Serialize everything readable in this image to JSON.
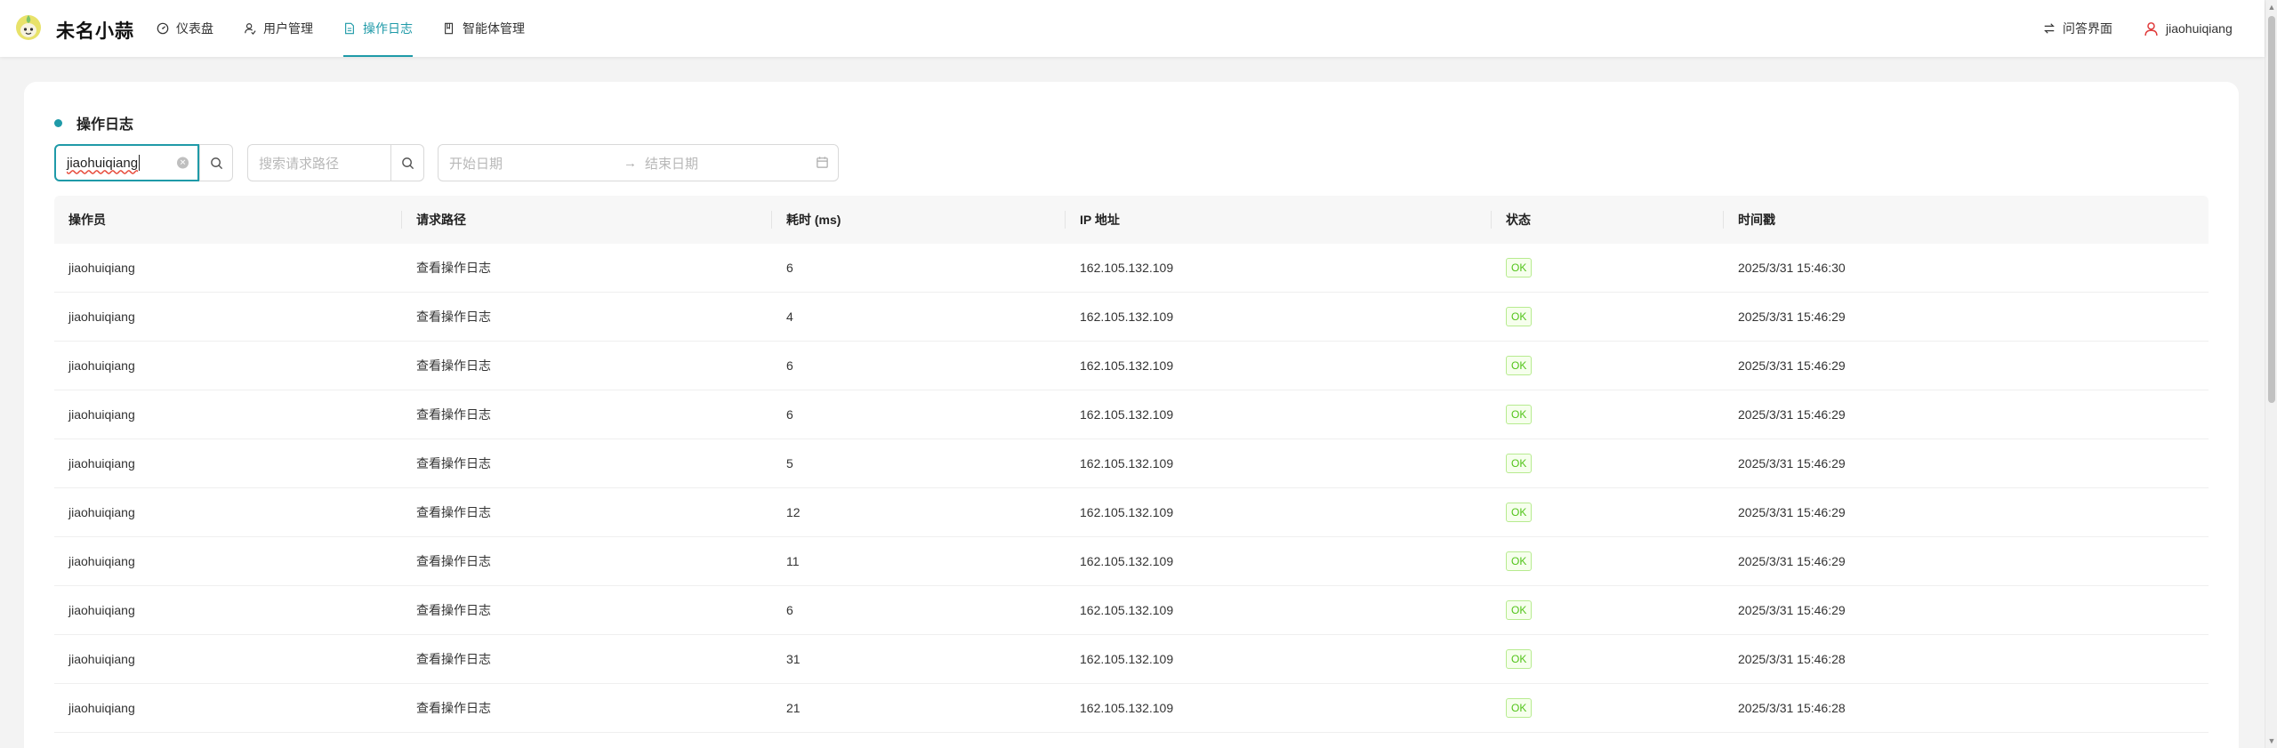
{
  "app": {
    "brand": "未名小蒜"
  },
  "nav": [
    {
      "label": "仪表盘",
      "icon": "dashboard-icon",
      "active": false
    },
    {
      "label": "用户管理",
      "icon": "user-manage-icon",
      "active": false
    },
    {
      "label": "操作日志",
      "icon": "document-icon",
      "active": true
    },
    {
      "label": "智能体管理",
      "icon": "book-icon",
      "active": false
    }
  ],
  "header_right": {
    "qa_label": "问答界面",
    "username": "jiaohuiqiang"
  },
  "page": {
    "title": "操作日志"
  },
  "filters": {
    "operator_value": "jiaohuiqiang",
    "path_placeholder": "搜索请求路径",
    "date_start_placeholder": "开始日期",
    "date_arrow": "→",
    "date_end_placeholder": "结束日期"
  },
  "table": {
    "columns": [
      "操作员",
      "请求路径",
      "耗时 (ms)",
      "IP 地址",
      "状态",
      "时间戳"
    ],
    "rows": [
      {
        "operator": "jiaohuiqiang",
        "path": "查看操作日志",
        "duration": "6",
        "ip": "162.105.132.109",
        "status": "OK",
        "timestamp": "2025/3/31 15:46:30"
      },
      {
        "operator": "jiaohuiqiang",
        "path": "查看操作日志",
        "duration": "4",
        "ip": "162.105.132.109",
        "status": "OK",
        "timestamp": "2025/3/31 15:46:29"
      },
      {
        "operator": "jiaohuiqiang",
        "path": "查看操作日志",
        "duration": "6",
        "ip": "162.105.132.109",
        "status": "OK",
        "timestamp": "2025/3/31 15:46:29"
      },
      {
        "operator": "jiaohuiqiang",
        "path": "查看操作日志",
        "duration": "6",
        "ip": "162.105.132.109",
        "status": "OK",
        "timestamp": "2025/3/31 15:46:29"
      },
      {
        "operator": "jiaohuiqiang",
        "path": "查看操作日志",
        "duration": "5",
        "ip": "162.105.132.109",
        "status": "OK",
        "timestamp": "2025/3/31 15:46:29"
      },
      {
        "operator": "jiaohuiqiang",
        "path": "查看操作日志",
        "duration": "12",
        "ip": "162.105.132.109",
        "status": "OK",
        "timestamp": "2025/3/31 15:46:29"
      },
      {
        "operator": "jiaohuiqiang",
        "path": "查看操作日志",
        "duration": "11",
        "ip": "162.105.132.109",
        "status": "OK",
        "timestamp": "2025/3/31 15:46:29"
      },
      {
        "operator": "jiaohuiqiang",
        "path": "查看操作日志",
        "duration": "6",
        "ip": "162.105.132.109",
        "status": "OK",
        "timestamp": "2025/3/31 15:46:29"
      },
      {
        "operator": "jiaohuiqiang",
        "path": "查看操作日志",
        "duration": "31",
        "ip": "162.105.132.109",
        "status": "OK",
        "timestamp": "2025/3/31 15:46:28"
      },
      {
        "operator": "jiaohuiqiang",
        "path": "查看操作日志",
        "duration": "21",
        "ip": "162.105.132.109",
        "status": "OK",
        "timestamp": "2025/3/31 15:46:28"
      }
    ]
  },
  "colors": {
    "accent": "#1f9aa8",
    "ok_text": "#52c41a",
    "ok_border": "#b7eb8f",
    "ok_bg": "#f6ffed"
  }
}
